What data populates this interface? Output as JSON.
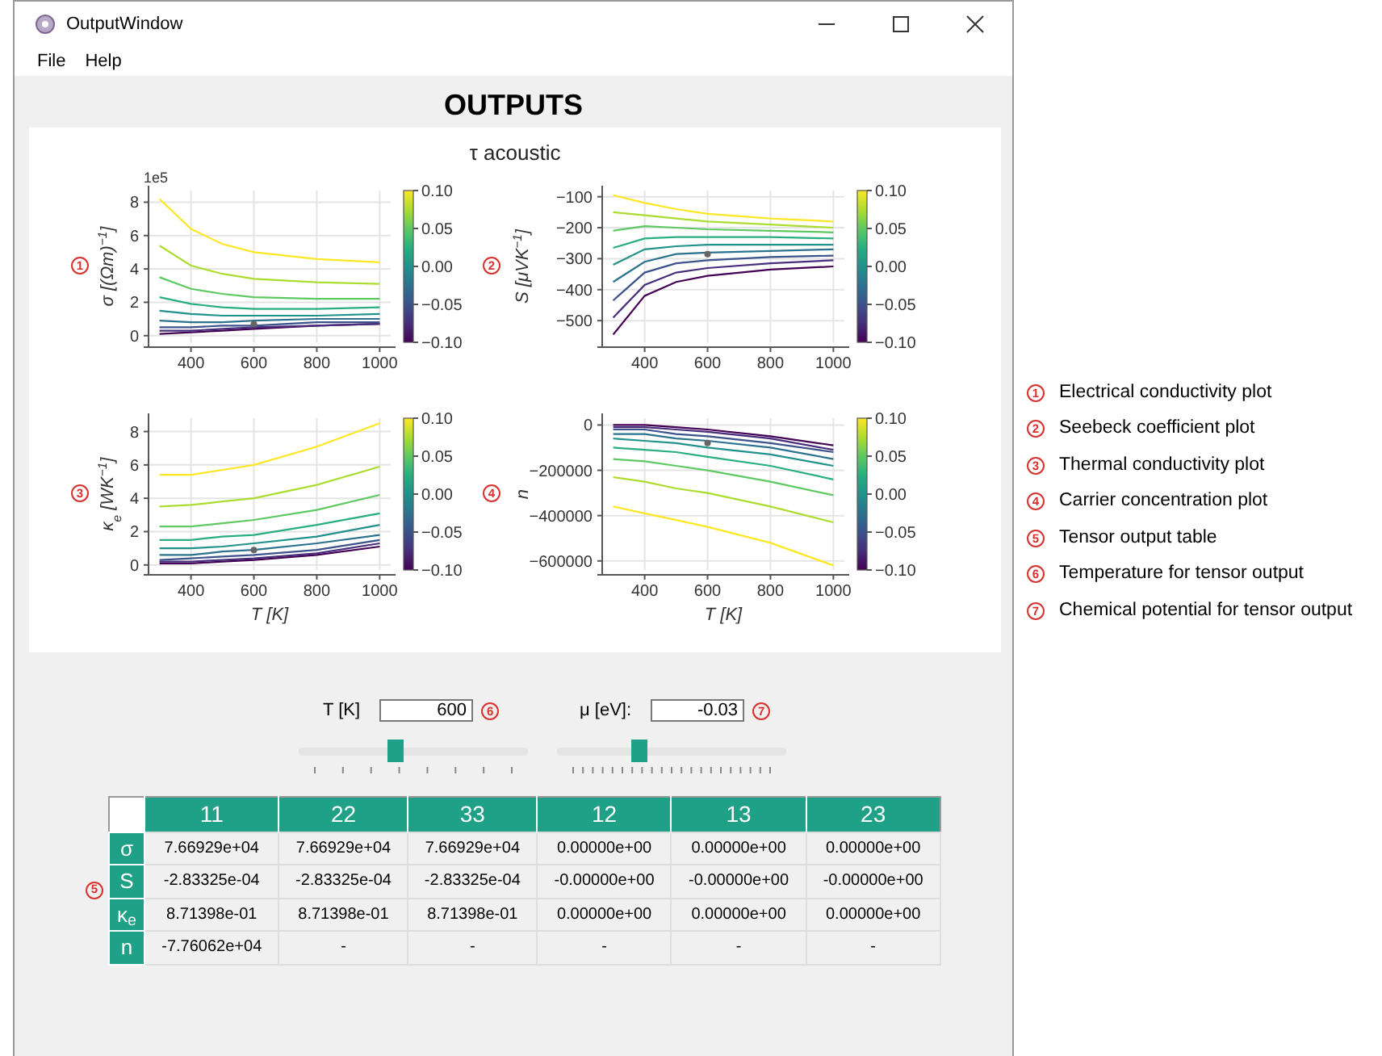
{
  "window": {
    "title": "OutputWindow"
  },
  "menu": [
    "File",
    "Help"
  ],
  "heading": "OUTPUTS",
  "plot_panel": {
    "title": "τ acoustic",
    "plots": [
      {
        "callout": "1",
        "offset_label": "1e5",
        "colorbar": {
          "ticks": [
            "0.10",
            "0.05",
            "0.00",
            "−0.05",
            "−0.10"
          ]
        },
        "chart_data": {
          "type": "line",
          "grid": true,
          "ylabel": "σ [(Ωm)$^{−1}$]",
          "x": [
            300,
            400,
            500,
            600,
            800,
            1000
          ],
          "xlim": [
            265,
            1035
          ],
          "ylim": [
            -0.4,
            8.7
          ],
          "xticks": [
            400,
            600,
            800,
            1000
          ],
          "yticks": [
            0,
            2,
            4,
            6,
            8
          ],
          "series": [
            {
              "color": "#440154",
              "values": [
                0.1,
                0.2,
                0.3,
                0.4,
                0.6,
                0.7
              ]
            },
            {
              "color": "#472d7b",
              "values": [
                0.3,
                0.3,
                0.4,
                0.5,
                0.6,
                0.7
              ]
            },
            {
              "color": "#3b528b",
              "values": [
                0.5,
                0.5,
                0.6,
                0.6,
                0.8,
                0.8
              ]
            },
            {
              "color": "#2c728e",
              "values": [
                0.9,
                0.8,
                0.8,
                0.9,
                1.0,
                1.0
              ]
            },
            {
              "color": "#21918c",
              "values": [
                1.5,
                1.3,
                1.2,
                1.2,
                1.2,
                1.3
              ]
            },
            {
              "color": "#28ae80",
              "values": [
                2.3,
                1.9,
                1.7,
                1.6,
                1.6,
                1.7
              ]
            },
            {
              "color": "#5ec962",
              "values": [
                3.5,
                2.8,
                2.5,
                2.3,
                2.2,
                2.2
              ]
            },
            {
              "color": "#addc30",
              "values": [
                5.4,
                4.2,
                3.7,
                3.4,
                3.2,
                3.1
              ]
            },
            {
              "color": "#fde725",
              "values": [
                8.2,
                6.4,
                5.5,
                5.0,
                4.6,
                4.4
              ]
            },
            {
              "color": "#666666",
              "marker": true,
              "values": [
                null,
                null,
                null,
                0.7,
                null,
                null
              ]
            }
          ]
        }
      },
      {
        "callout": "2",
        "colorbar": {
          "ticks": [
            "0.10",
            "0.05",
            "0.00",
            "−0.05",
            "−0.10"
          ]
        },
        "chart_data": {
          "type": "line",
          "grid": true,
          "ylabel": "S [μVK$^{−1}$]",
          "x": [
            300,
            400,
            500,
            600,
            800,
            1000
          ],
          "xlim": [
            265,
            1035
          ],
          "ylim": [
            -570,
            -80
          ],
          "xticks": [
            400,
            600,
            800,
            1000
          ],
          "yticks": [
            {
              "value": -500,
              "label": "−500"
            },
            {
              "value": -400,
              "label": "−400"
            },
            {
              "value": -300,
              "label": "−300"
            },
            {
              "value": -200,
              "label": "−200"
            },
            {
              "value": -100,
              "label": "−100"
            }
          ],
          "series": [
            {
              "color": "#440154",
              "values": [
                -545,
                -420,
                -375,
                -355,
                -335,
                -325
              ]
            },
            {
              "color": "#472d7b",
              "values": [
                -490,
                -385,
                -345,
                -330,
                -315,
                -305
              ]
            },
            {
              "color": "#3b528b",
              "values": [
                -435,
                -345,
                -315,
                -305,
                -295,
                -290
              ]
            },
            {
              "color": "#2c728e",
              "values": [
                -375,
                -310,
                -285,
                -280,
                -275,
                -270
              ]
            },
            {
              "color": "#21918c",
              "values": [
                -320,
                -270,
                -260,
                -255,
                -255,
                -255
              ]
            },
            {
              "color": "#28ae80",
              "values": [
                -265,
                -235,
                -230,
                -230,
                -230,
                -235
              ]
            },
            {
              "color": "#5ec962",
              "values": [
                -210,
                -195,
                -200,
                -205,
                -210,
                -215
              ]
            },
            {
              "color": "#addc30",
              "values": [
                -150,
                -160,
                -170,
                -180,
                -190,
                -200
              ]
            },
            {
              "color": "#fde725",
              "values": [
                -95,
                -120,
                -140,
                -155,
                -170,
                -180
              ]
            },
            {
              "color": "#666666",
              "marker": true,
              "values": [
                null,
                null,
                null,
                -285,
                null,
                null
              ]
            }
          ]
        }
      },
      {
        "callout": "3",
        "colorbar": {
          "ticks": [
            "0.10",
            "0.05",
            "0.00",
            "−0.05",
            "−0.10"
          ]
        },
        "chart_data": {
          "type": "line",
          "grid": true,
          "xlabel": "T [K]",
          "ylabel": "κ$_{e}$ [WK$^{−1}$]",
          "x": [
            300,
            400,
            500,
            600,
            800,
            1000
          ],
          "xlim": [
            265,
            1035
          ],
          "ylim": [
            -0.3,
            8.8
          ],
          "xticks": [
            400,
            600,
            800,
            1000
          ],
          "yticks": [
            0,
            2,
            4,
            6,
            8
          ],
          "series": [
            {
              "color": "#440154",
              "values": [
                0.1,
                0.1,
                0.2,
                0.3,
                0.6,
                1.1
              ]
            },
            {
              "color": "#472d7b",
              "values": [
                0.2,
                0.2,
                0.3,
                0.4,
                0.7,
                1.3
              ]
            },
            {
              "color": "#3b528b",
              "values": [
                0.3,
                0.4,
                0.5,
                0.6,
                0.9,
                1.5
              ]
            },
            {
              "color": "#2c728e",
              "values": [
                0.6,
                0.6,
                0.8,
                0.9,
                1.3,
                1.8
              ]
            },
            {
              "color": "#21918c",
              "values": [
                1.0,
                1.0,
                1.1,
                1.3,
                1.7,
                2.4
              ]
            },
            {
              "color": "#28ae80",
              "values": [
                1.5,
                1.5,
                1.7,
                1.8,
                2.4,
                3.1
              ]
            },
            {
              "color": "#5ec962",
              "values": [
                2.3,
                2.3,
                2.5,
                2.7,
                3.3,
                4.2
              ]
            },
            {
              "color": "#addc30",
              "values": [
                3.5,
                3.6,
                3.8,
                4.0,
                4.8,
                5.9
              ]
            },
            {
              "color": "#fde725",
              "values": [
                5.4,
                5.4,
                5.7,
                6.0,
                7.1,
                8.5
              ]
            },
            {
              "color": "#666666",
              "marker": true,
              "values": [
                null,
                null,
                null,
                0.9,
                null,
                null
              ]
            }
          ]
        }
      },
      {
        "callout": "4",
        "colorbar": {
          "ticks": [
            "0.10",
            "0.05",
            "0.00",
            "−0.05",
            "−0.10"
          ]
        },
        "chart_data": {
          "type": "line",
          "grid": true,
          "xlabel": "T [K]",
          "ylabel": "n",
          "x": [
            300,
            400,
            500,
            600,
            800,
            1000
          ],
          "xlim": [
            265,
            1035
          ],
          "ylim": [
            -640000,
            30000
          ],
          "xticks": [
            400,
            600,
            800,
            1000
          ],
          "yticks": [
            {
              "value": -600000,
              "label": "−600000"
            },
            {
              "value": -400000,
              "label": "−400000"
            },
            {
              "value": -200000,
              "label": "−200000"
            },
            0
          ],
          "series": [
            {
              "color": "#440154",
              "values": [
                0,
                0,
                -10000,
                -20000,
                -50000,
                -90000
              ]
            },
            {
              "color": "#472d7b",
              "values": [
                -10000,
                -10000,
                -20000,
                -30000,
                -60000,
                -110000
              ]
            },
            {
              "color": "#3b528b",
              "values": [
                -20000,
                -20000,
                -40000,
                -50000,
                -80000,
                -120000
              ]
            },
            {
              "color": "#2c728e",
              "values": [
                -40000,
                -40000,
                -60000,
                -70000,
                -100000,
                -150000
              ]
            },
            {
              "color": "#21918c",
              "values": [
                -60000,
                -70000,
                -80000,
                -100000,
                -130000,
                -180000
              ]
            },
            {
              "color": "#28ae80",
              "values": [
                -100000,
                -110000,
                -120000,
                -140000,
                -180000,
                -240000
              ]
            },
            {
              "color": "#5ec962",
              "values": [
                -150000,
                -160000,
                -180000,
                -200000,
                -250000,
                -310000
              ]
            },
            {
              "color": "#addc30",
              "values": [
                -230000,
                -250000,
                -280000,
                -300000,
                -360000,
                -430000
              ]
            },
            {
              "color": "#fde725",
              "values": [
                -360000,
                -390000,
                -420000,
                -450000,
                -520000,
                -620000
              ]
            },
            {
              "color": "#666666",
              "marker": true,
              "values": [
                null,
                null,
                null,
                -80000,
                null,
                null
              ]
            }
          ]
        }
      }
    ]
  },
  "controls": [
    {
      "label": "T [K]",
      "value": "600",
      "callout": "6",
      "level": 0.42
    },
    {
      "label": "μ [eV]:",
      "value": "-0.03",
      "callout": "7",
      "level": 0.35
    }
  ],
  "table": {
    "callout": "5",
    "columns": [
      "11",
      "22",
      "33",
      "12",
      "13",
      "23"
    ],
    "rows": [
      {
        "label": "σ",
        "cells": [
          "7.66929e+04",
          "7.66929e+04",
          "7.66929e+04",
          "0.00000e+00",
          "0.00000e+00",
          "0.00000e+00"
        ]
      },
      {
        "label": "S",
        "cells": [
          "-2.83325e-04",
          "-2.83325e-04",
          "-2.83325e-04",
          "-0.00000e+00",
          "-0.00000e+00",
          "-0.00000e+00"
        ]
      },
      {
        "label": "κ$_{e}$",
        "cells": [
          "8.71398e-01",
          "8.71398e-01",
          "8.71398e-01",
          "0.00000e+00",
          "0.00000e+00",
          "0.00000e+00"
        ]
      },
      {
        "label": "n",
        "cells": [
          "-7.76062e+04",
          "-",
          "-",
          "-",
          "-",
          "-"
        ]
      }
    ]
  },
  "legend": [
    {
      "number": "1",
      "text": "Electrical conductivity plot"
    },
    {
      "number": "2",
      "text": "Seebeck coefficient plot"
    },
    {
      "number": "3",
      "text": "Thermal conductivity plot"
    },
    {
      "number": "4",
      "text": "Carrier concentration plot"
    },
    {
      "number": "5",
      "text": "Tensor output table"
    },
    {
      "number": "6",
      "text": "Temperature for tensor output"
    },
    {
      "number": "7",
      "text": "Chemical potential for tensor output"
    }
  ]
}
